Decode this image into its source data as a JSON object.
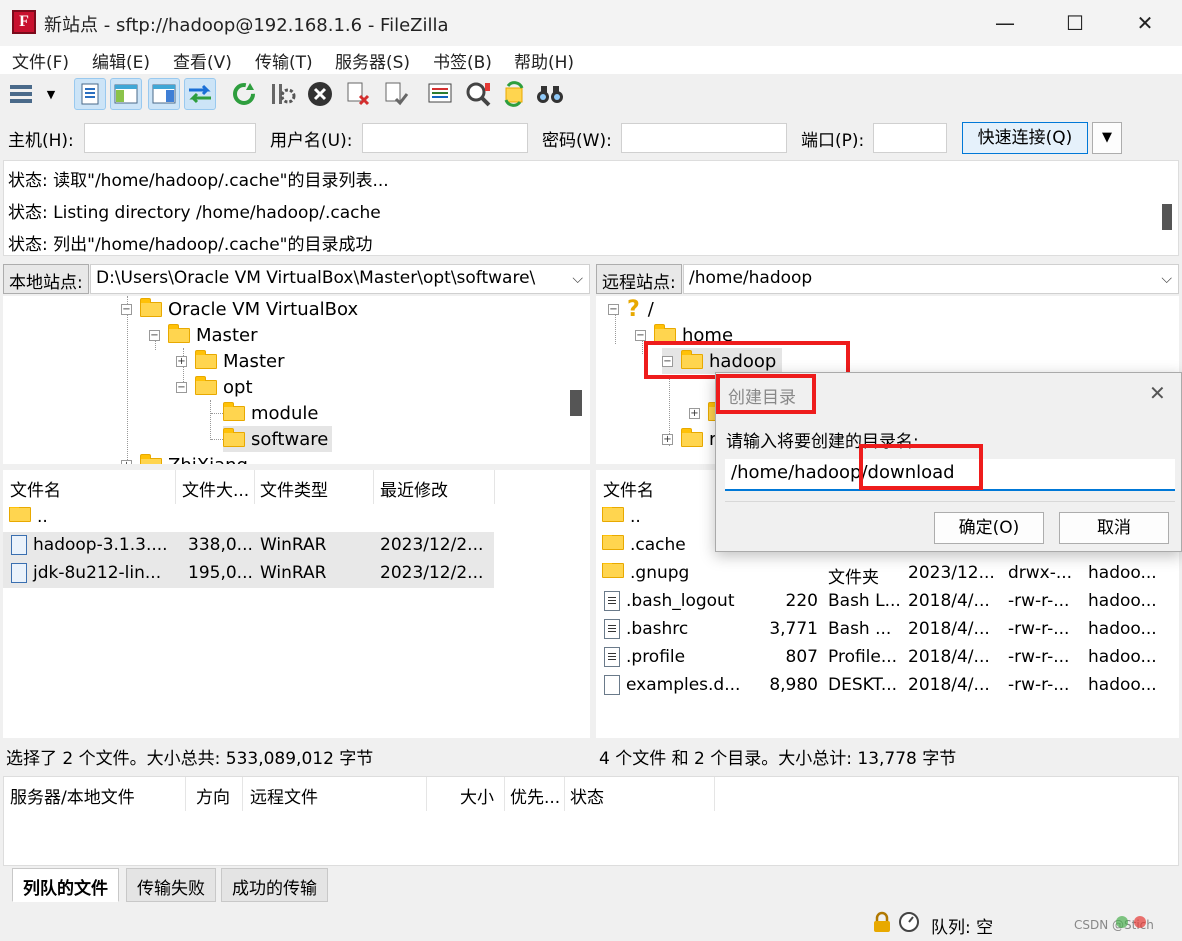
{
  "window": {
    "title": "新站点 - sftp://hadoop@192.168.1.6 - FileZilla",
    "app_icon_letter": "F",
    "minimize": "—",
    "maximize": "☐",
    "close": "✕"
  },
  "menu": [
    "文件(F)",
    "编辑(E)",
    "查看(V)",
    "传输(T)",
    "服务器(S)",
    "书签(B)",
    "帮助(H)"
  ],
  "quickconnect": {
    "host_label": "主机(H):",
    "host_value": "",
    "user_label": "用户名(U):",
    "user_value": "",
    "password_label": "密码(W):",
    "password_value": "",
    "port_label": "端口(P):",
    "port_value": "",
    "connect_label": "快速连接(Q)",
    "dropdown_arrow": "▼"
  },
  "log": [
    "状态: 读取\"/home/hadoop/.cache\"的目录列表...",
    "状态: Listing directory /home/hadoop/.cache",
    "状态: 列出\"/home/hadoop/.cache\"的目录成功"
  ],
  "local": {
    "site_label": "本地站点:",
    "path": "D:\\Users\\Oracle VM VirtualBox\\Master\\opt\\software\\",
    "tree": [
      {
        "label": "Oracle VM VirtualBox"
      },
      {
        "label": "Master"
      },
      {
        "label": "Master"
      },
      {
        "label": "opt"
      },
      {
        "label": "module"
      },
      {
        "label": "software"
      },
      {
        "label": "ZhiXiang"
      }
    ],
    "columns": [
      "文件名",
      "文件大...",
      "文件类型",
      "最近修改"
    ],
    "files": [
      {
        "name": "..",
        "size": "",
        "type": "",
        "modified": ""
      },
      {
        "name": "hadoop-3.1.3....",
        "size": "338,0...",
        "type": "WinRAR",
        "modified": "2023/12/2..."
      },
      {
        "name": "jdk-8u212-lin...",
        "size": "195,0...",
        "type": "WinRAR",
        "modified": "2023/12/2..."
      }
    ],
    "status": "选择了 2 个文件。大小总共: 533,089,012 字节"
  },
  "remote": {
    "site_label": "远程站点:",
    "path": "/home/hadoop",
    "tree": [
      {
        "label": "/"
      },
      {
        "label": "home"
      },
      {
        "label": "hadoop"
      },
      {
        "label": "r"
      }
    ],
    "columns": [
      "文件名"
    ],
    "files": [
      {
        "name": "..",
        "size": "",
        "type": "",
        "modified": "",
        "perm": "",
        "owner": ""
      },
      {
        "name": ".cache",
        "size": "",
        "type": "",
        "modified": "",
        "perm": "",
        "owner": ""
      },
      {
        "name": ".gnupg",
        "size": "",
        "type": "文件夹",
        "modified": "2023/12...",
        "perm": "drwx-...",
        "owner": "hadoo..."
      },
      {
        "name": ".bash_logout",
        "size": "220",
        "type": "Bash L...",
        "modified": "2018/4/...",
        "perm": "-rw-r-...",
        "owner": "hadoo..."
      },
      {
        "name": ".bashrc",
        "size": "3,771",
        "type": "Bash ...",
        "modified": "2018/4/...",
        "perm": "-rw-r-...",
        "owner": "hadoo..."
      },
      {
        "name": ".profile",
        "size": "807",
        "type": "Profile...",
        "modified": "2018/4/...",
        "perm": "-rw-r-...",
        "owner": "hadoo..."
      },
      {
        "name": "examples.d...",
        "size": "8,980",
        "type": "DESKT...",
        "modified": "2018/4/...",
        "perm": "-rw-r-...",
        "owner": "hadoo..."
      }
    ],
    "status": "4 个文件 和 2 个目录。大小总计: 13,778 字节"
  },
  "queue": {
    "columns": [
      "服务器/本地文件",
      "方向",
      "远程文件",
      "大小",
      "优先...",
      "状态"
    ],
    "tabs": [
      "列队的文件",
      "传输失败",
      "成功的传输"
    ]
  },
  "statusbar": {
    "queue_text": "队列: 空",
    "watermark": "CSDN @Stich"
  },
  "dialog": {
    "title": "创建目录",
    "prompt": "请输入将要创建的目录名:",
    "input_value": "/home/hadoop/download",
    "ok_label": "确定(O)",
    "cancel_label": "取消",
    "close": "✕"
  },
  "colors": {
    "highlight_red": "#ee1c1c",
    "accent_blue": "#0078d7",
    "folder_yellow": "#ffd54f"
  }
}
